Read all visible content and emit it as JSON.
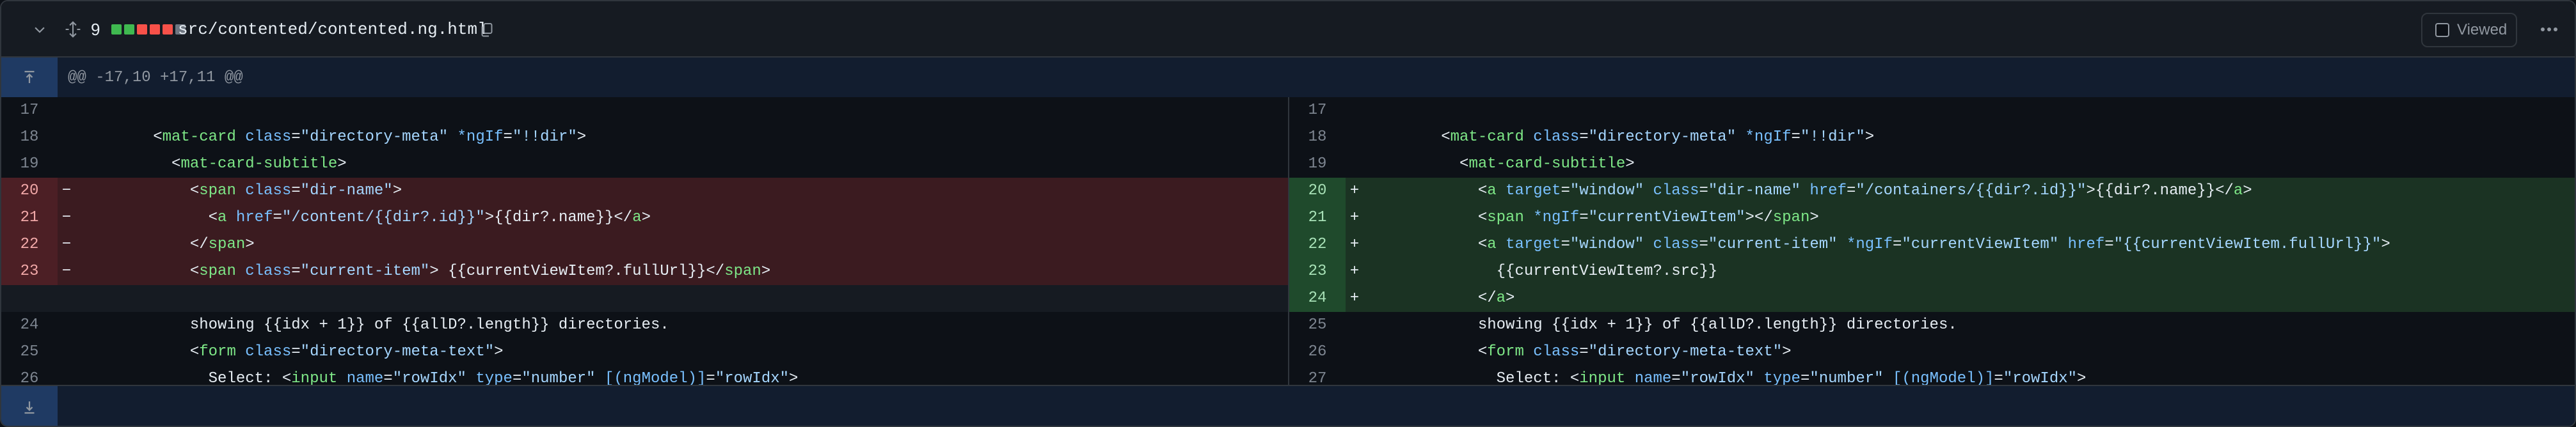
{
  "header": {
    "change_count": "9",
    "diffstat_colors": [
      "#3fb950",
      "#3fb950",
      "#f85149",
      "#f85149",
      "#f85149",
      "#6e7681"
    ],
    "file_name": "src/contented/contented.ng.html",
    "viewed_label": "Viewed",
    "icons": {
      "collapse": "chevron-down-icon",
      "expand": "unfold-icon",
      "copy": "copy-icon",
      "more": "kebab-horizontal-icon"
    }
  },
  "hunk": {
    "header_text": "@@ -17,10 +17,11 @@",
    "expand_icon": "expand-up-icon"
  },
  "left": {
    "rows": [
      {
        "type": "context",
        "num": "17",
        "code": ""
      },
      {
        "type": "context",
        "num": "18",
        "code": "        <mat-card class=\"directory-meta\" *ngIf=\"!!dir\">"
      },
      {
        "type": "context",
        "num": "19",
        "code": "          <mat-card-subtitle>"
      },
      {
        "type": "del",
        "num": "20",
        "code": "            <span class=\"dir-name\">"
      },
      {
        "type": "del",
        "num": "21",
        "code": "              <a href=\"/content/{{dir?.id}}\">{{dir?.name}}</a>"
      },
      {
        "type": "del",
        "num": "22",
        "code": "            </span>"
      },
      {
        "type": "del",
        "num": "23",
        "code": "            <span class=\"current-item\"> {{currentViewItem?.fullUrl}}</span>"
      },
      {
        "type": "empty",
        "num": "",
        "code": ""
      },
      {
        "type": "context",
        "num": "24",
        "code": "            showing {{idx + 1}} of {{allD?.length}} directories."
      },
      {
        "type": "context",
        "num": "25",
        "code": "            <form class=\"directory-meta-text\">"
      },
      {
        "type": "context",
        "num": "26",
        "code": "              Select: <input name=\"rowIdx\" type=\"number\" [(ngModel)]=\"rowIdx\">"
      }
    ]
  },
  "right": {
    "rows": [
      {
        "type": "context",
        "num": "17",
        "code": ""
      },
      {
        "type": "context",
        "num": "18",
        "code": "        <mat-card class=\"directory-meta\" *ngIf=\"!!dir\">"
      },
      {
        "type": "context",
        "num": "19",
        "code": "          <mat-card-subtitle>"
      },
      {
        "type": "add",
        "num": "20",
        "code": "            <a target=\"window\" class=\"dir-name\" href=\"/containers/{{dir?.id}}\">{{dir?.name}}</a>"
      },
      {
        "type": "add",
        "num": "21",
        "code": "            <span *ngIf=\"currentViewItem\"></span>"
      },
      {
        "type": "add",
        "num": "22",
        "code": "            <a target=\"window\" class=\"current-item\" *ngIf=\"currentViewItem\" href=\"{{currentViewItem.fullUrl}}\">"
      },
      {
        "type": "add",
        "num": "23",
        "code": "              {{currentViewItem?.src}}"
      },
      {
        "type": "add",
        "num": "24",
        "code": "            </a>"
      },
      {
        "type": "context",
        "num": "25",
        "code": "            showing {{idx + 1}} of {{allD?.length}} directories."
      },
      {
        "type": "context",
        "num": "26",
        "code": "            <form class=\"directory-meta-text\">"
      },
      {
        "type": "context",
        "num": "27",
        "code": "              Select: <input name=\"rowIdx\" type=\"number\" [(ngModel)]=\"rowIdx\">"
      }
    ]
  },
  "footer": {
    "expand_icon": "expand-down-icon"
  }
}
